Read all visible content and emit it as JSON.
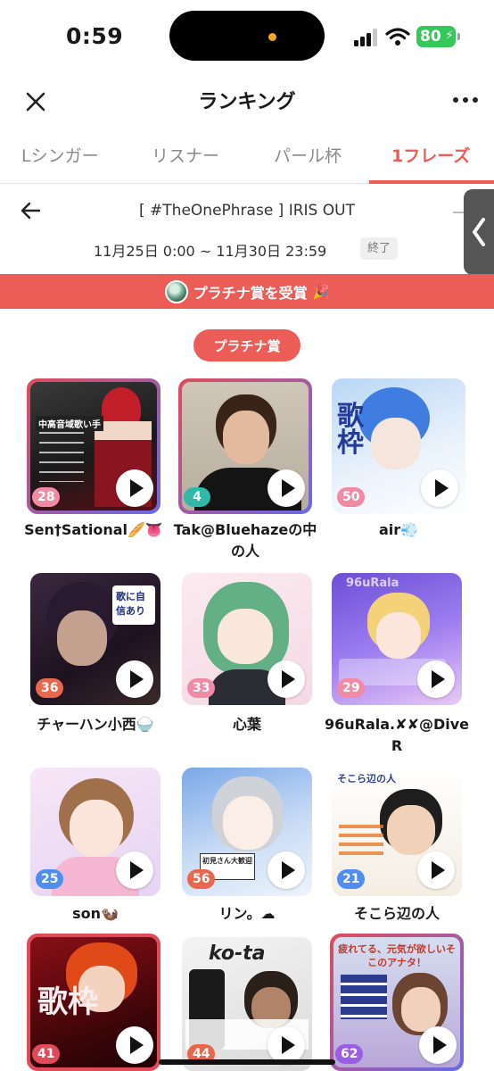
{
  "status_bar": {
    "time": "0:59",
    "battery": "80"
  },
  "header": {
    "title": "ランキング"
  },
  "tabs": [
    {
      "label": "Lシンガー",
      "active": false
    },
    {
      "label": "リスナー",
      "active": false
    },
    {
      "label": "パール杯",
      "active": false
    },
    {
      "label": "1フレーズ",
      "active": true
    }
  ],
  "event": {
    "title": "[ #TheOnePhrase ] IRIS OUT",
    "period": "11月25日 0:00 ~ 11月30日 23:59",
    "status": "終了"
  },
  "banner": {
    "text": "プラチナ賞を受賞",
    "emoji": "🎉"
  },
  "section": {
    "label": "プラチナ賞"
  },
  "colors": {
    "accent": "#ec5d58",
    "platinum_frame": "#e04b5a",
    "blue_frame": "#4f7df0"
  },
  "entries": [
    {
      "name": "Sen†Sational🥖👅",
      "count": "28",
      "art_text": "中高音域歌い手"
    },
    {
      "name": "Tak@Bluehazeの中の人",
      "count": "4",
      "art_text": ""
    },
    {
      "name": "air💨",
      "count": "50",
      "art_text": "歌枠"
    },
    {
      "name": "チャーハン小西🍚",
      "count": "36",
      "art_text": "歌に自信あり"
    },
    {
      "name": "心葉",
      "count": "33",
      "art_text": ""
    },
    {
      "name": "96uRala.✘✘@DiveR",
      "count": "29",
      "art_text": "96uRala"
    },
    {
      "name": "son🦦",
      "count": "25",
      "art_text": ""
    },
    {
      "name": "リン。☁",
      "count": "56",
      "art_text": "初見さん大歓迎"
    },
    {
      "name": "そこら辺の人",
      "count": "21",
      "art_text": "そこら辺の人"
    },
    {
      "name": "",
      "count": "41",
      "art_text": "歌枠"
    },
    {
      "name": "",
      "count": "44",
      "art_text": "ko-ta"
    },
    {
      "name": "",
      "count": "62",
      "art_text": "疲れてる、元気が欲しいそこのアナタ！"
    }
  ]
}
